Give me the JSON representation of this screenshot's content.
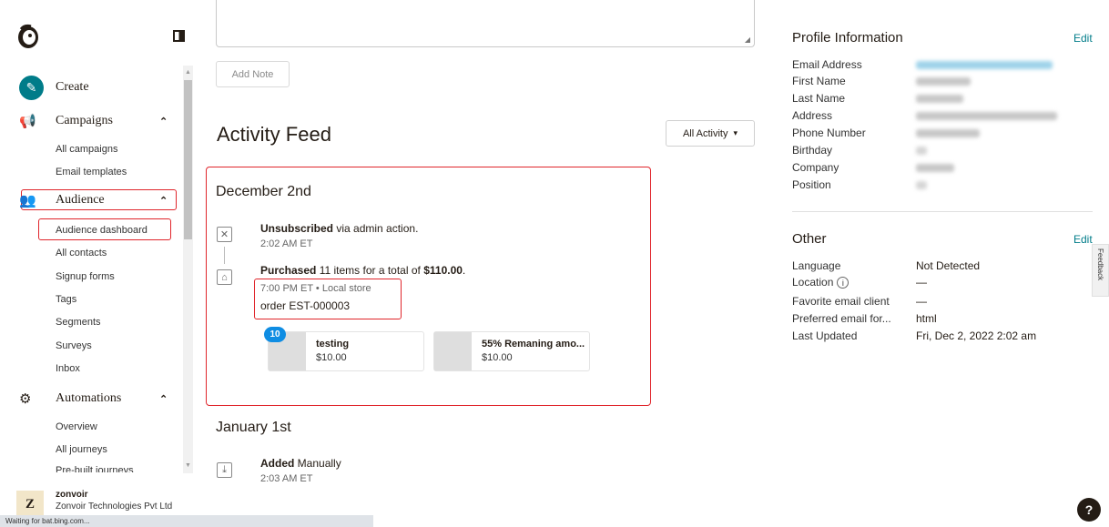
{
  "sidebar": {
    "create_label": "Create",
    "sections": {
      "campaigns": {
        "label": "Campaigns",
        "items": [
          "All campaigns",
          "Email templates"
        ]
      },
      "audience": {
        "label": "Audience",
        "items": [
          "Audience dashboard",
          "All contacts",
          "Signup forms",
          "Tags",
          "Segments",
          "Surveys",
          "Inbox"
        ]
      },
      "automations": {
        "label": "Automations",
        "items": [
          "Overview",
          "All journeys",
          "Pre-built journeys"
        ]
      }
    },
    "account": {
      "avatar_letter": "Z",
      "name": "zonvoir",
      "org": "Zonvoir Technologies Pvt Ltd"
    }
  },
  "statusbar": {
    "text": "Waiting for bat.bing.com..."
  },
  "main": {
    "add_note_label": "Add Note",
    "feed_title": "Activity Feed",
    "filter_label": "All Activity",
    "groups": [
      {
        "date": "December 2nd",
        "events": [
          {
            "title_bold": "Unsubscribed",
            "title_rest": " via admin action.",
            "time": "2:02 AM ET",
            "icon": "unsubscribe-icon"
          },
          {
            "title_bold": "Purchased",
            "title_mid": " 11 items for a total of ",
            "title_amount": "$110.00",
            "title_end": ".",
            "time": "7:00 PM ET • Local store",
            "order": "order EST-000003",
            "icon": "store-icon",
            "products": [
              {
                "name": "testing",
                "price": "$10.00",
                "qty": "10"
              },
              {
                "name": "55% Remaning amo...",
                "price": "$10.00"
              }
            ]
          }
        ]
      },
      {
        "date": "January 1st",
        "events": [
          {
            "title_bold": "Added",
            "title_rest": " Manually",
            "time": "2:03 AM ET",
            "icon": "download-icon"
          }
        ]
      }
    ]
  },
  "profile": {
    "title": "Profile Information",
    "edit_label": "Edit",
    "fields": [
      "Email Address",
      "First Name",
      "Last Name",
      "Address",
      "Phone Number",
      "Birthday",
      "Company",
      "Position"
    ]
  },
  "other": {
    "title": "Other",
    "edit_label": "Edit",
    "rows": [
      {
        "label": "Language",
        "value": "Not Detected"
      },
      {
        "label": "Location",
        "value": "—"
      },
      {
        "label": "Favorite email client",
        "value": "—"
      },
      {
        "label": "Preferred email for...",
        "value": "html"
      },
      {
        "label": "Last Updated",
        "value": "Fri, Dec 2, 2022 2:02 am"
      }
    ]
  },
  "feedback_label": "Feedback",
  "help_label": "?",
  "colors": {
    "accent": "#007c89",
    "highlight": "#e0252b",
    "badge": "#0f8de3"
  }
}
